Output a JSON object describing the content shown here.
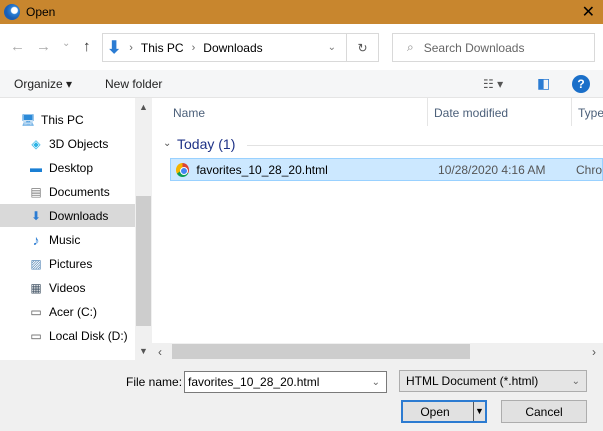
{
  "window": {
    "title": "Open",
    "close": "✕"
  },
  "nav": {
    "back": "←",
    "forward": "→",
    "recent": "⌄",
    "up": "↑",
    "breadcrumb": [
      "This PC",
      "Downloads"
    ],
    "refresh": "↻",
    "search_placeholder": "Search Downloads"
  },
  "toolbar": {
    "organize": "Organize ▾",
    "new_folder": "New folder",
    "view": "☷ ▾",
    "preview": "◧",
    "help": "?"
  },
  "sidebar": {
    "items": [
      {
        "label": "This PC",
        "icon": "🖥"
      },
      {
        "label": "3D Objects",
        "icon": "◈"
      },
      {
        "label": "Desktop",
        "icon": "▬"
      },
      {
        "label": "Documents",
        "icon": "▤"
      },
      {
        "label": "Downloads",
        "icon": "⬇"
      },
      {
        "label": "Music",
        "icon": "♪"
      },
      {
        "label": "Pictures",
        "icon": "▨"
      },
      {
        "label": "Videos",
        "icon": "▦"
      },
      {
        "label": "Acer (C:)",
        "icon": "▭"
      },
      {
        "label": "Local Disk (D:)",
        "icon": "▭"
      }
    ]
  },
  "columns": {
    "name": "Name",
    "date": "Date modified",
    "type": "Type"
  },
  "group": "Today (1)",
  "files": [
    {
      "name": "favorites_10_28_20.html",
      "date": "10/28/2020 4:16 AM",
      "type": "Chro"
    }
  ],
  "bottom": {
    "file_name_label": "File name:",
    "file_name_value": "favorites_10_28_20.html",
    "file_type": "HTML Document (*.html)",
    "open": "Open",
    "cancel": "Cancel"
  }
}
